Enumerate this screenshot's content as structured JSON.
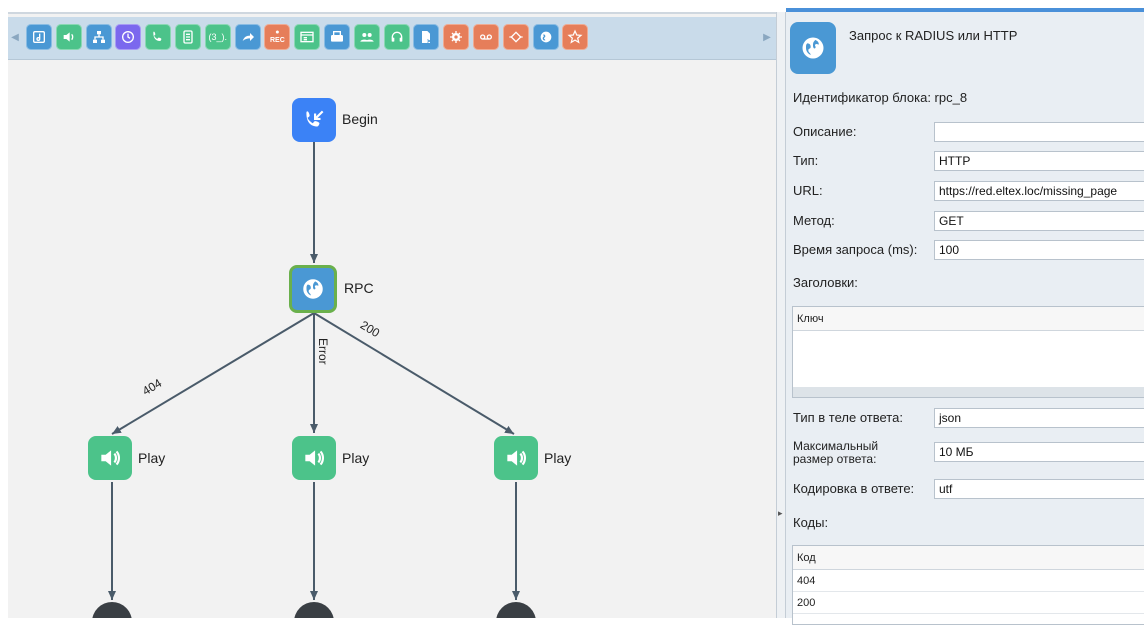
{
  "colors": {
    "toolbar_bg": "#c9dbea",
    "teal": "#48bba4",
    "blue": "#4a98d4",
    "green": "#4cc38a",
    "orange": "#e67e5a",
    "begin_blue": "#3b82f6",
    "rpc_border": "#6ab04c",
    "edge": "#4a5b6a"
  },
  "toolbar": {
    "buttons": [
      {
        "icon": "music-icon",
        "color": "#4a98d4"
      },
      {
        "icon": "speaker-icon",
        "color": "#4cc38a"
      },
      {
        "icon": "network-icon",
        "color": "#4a98d4"
      },
      {
        "icon": "clock-icon",
        "color": "#7b68ee"
      },
      {
        "icon": "phone-icon",
        "color": "#4cc38a"
      },
      {
        "icon": "form-icon",
        "color": "#4cc38a"
      },
      {
        "icon": "dialtext-icon",
        "color": "#4cc38a",
        "text": "(3_)."
      },
      {
        "icon": "forward-icon",
        "color": "#4a98d4"
      },
      {
        "icon": "rec-icon",
        "color": "#e67e5a",
        "text": "REC"
      },
      {
        "icon": "window-icon",
        "color": "#4cc38a"
      },
      {
        "icon": "fax-icon",
        "color": "#4a98d4"
      },
      {
        "icon": "users-icon",
        "color": "#4cc38a"
      },
      {
        "icon": "headset-icon",
        "color": "#4cc38a"
      },
      {
        "icon": "document-icon",
        "color": "#4a98d4"
      },
      {
        "icon": "gear-icon",
        "color": "#e67e5a"
      },
      {
        "icon": "voicemail-icon",
        "color": "#e67e5a"
      },
      {
        "icon": "condition-icon",
        "color": "#e67e5a"
      },
      {
        "icon": "globe-icon",
        "color": "#4a98d4"
      },
      {
        "icon": "star-icon",
        "color": "#e67e5a"
      }
    ]
  },
  "diagram": {
    "nodes": [
      {
        "id": "begin",
        "label": "Begin"
      },
      {
        "id": "rpc",
        "label": "RPC"
      },
      {
        "id": "play1",
        "label": "Play"
      },
      {
        "id": "play2",
        "label": "Play"
      },
      {
        "id": "play3",
        "label": "Play"
      }
    ],
    "edge_labels": {
      "e404": "404",
      "error": "Error",
      "e200": "200"
    }
  },
  "panel": {
    "title": "Запрос к RADIUS или HTTP",
    "block_id_label": "Идентификатор блока: rpc_8",
    "description_label": "Описание:",
    "description_value": "",
    "type_label": "Тип:",
    "type_value": "HTTP",
    "url_label": "URL:",
    "url_value": "https://red.eltex.loc/missing_page",
    "method_label": "Метод:",
    "method_value": "GET",
    "timeout_label": "Время запроса (ms):",
    "timeout_value": "100",
    "headers_label": "Заголовки:",
    "headers_col": "Ключ",
    "body_type_label": "Тип в теле ответа:",
    "body_type_value": "json",
    "max_size_label_1": "Максимальный",
    "max_size_label_2": "размер ответа:",
    "max_size_value": "10 МБ",
    "encoding_label": "Кодировка в ответе:",
    "encoding_value": "utf",
    "codes_label": "Коды:",
    "codes_col": "Код",
    "codes": [
      "404",
      "200"
    ]
  }
}
